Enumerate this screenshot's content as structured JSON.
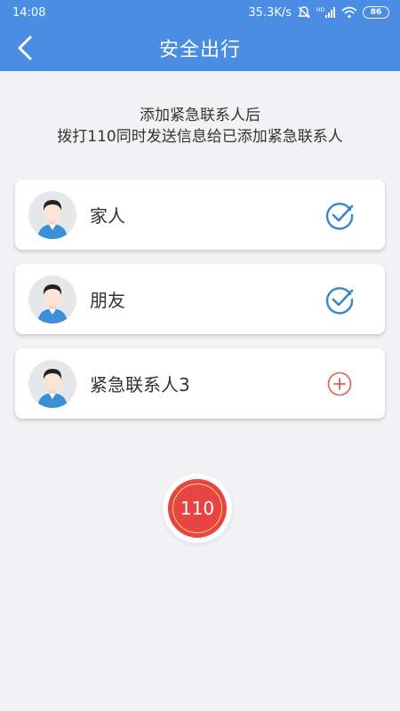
{
  "status_bar": {
    "time": "14:08",
    "network_speed": "35.3K/s",
    "signal_badge": "HD",
    "battery": "86",
    "icons": [
      "mute-icon",
      "signal-icon",
      "wifi-icon",
      "battery-icon"
    ]
  },
  "app_bar": {
    "title": "安全出行",
    "back_icon": "chevron-left-icon"
  },
  "intro": {
    "line1": "添加紧急联系人后",
    "line2": "拨打110同时发送信息给已添加紧急联系人"
  },
  "contacts": [
    {
      "name": "家人",
      "status": "added",
      "icon": "check-circle-icon"
    },
    {
      "name": "朋友",
      "status": "added",
      "icon": "check-circle-icon"
    },
    {
      "name": "紧急联系人3",
      "status": "empty",
      "icon": "plus-circle-icon"
    }
  ],
  "call_button": {
    "label": "110"
  },
  "colors": {
    "primary": "#4a8de2",
    "check": "#3a86c8",
    "add": "#e45a5a",
    "call_red": "#e74444",
    "call_ring": "#f5d76e",
    "background": "#f2f2f4"
  }
}
